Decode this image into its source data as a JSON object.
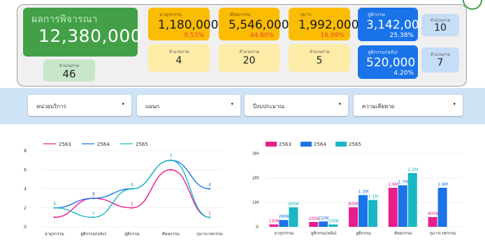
{
  "colors": {
    "green": "#43a047",
    "orange": "#fbbc04",
    "pale_yellow": "#fdeca8",
    "blue": "#1a73e8",
    "light_blue": "#c6ddf7",
    "pink": "#e91e8c",
    "teal": "#1ab8c4",
    "red": "#ea4335"
  },
  "summary": {
    "main_title": "ผลการพิจารณา",
    "main_value": "12,380,000",
    "count_label": "จำนวนราย",
    "count_value": "46",
    "cards": [
      {
        "title": "อายุรกรรม",
        "value": "1,180,000",
        "pct": "9.53%",
        "count_label": "จำนวนราย",
        "count": "4"
      },
      {
        "title": "ศัลยกรรม",
        "value": "5,546,000",
        "pct": "44.80%",
        "count_label": "จำนวนราย",
        "count": "20"
      },
      {
        "title": "กุมาร",
        "value": "1,992,000",
        "pct": "16.09%",
        "count_label": "จำนวนราย",
        "count": "5"
      }
    ],
    "blue_cards": [
      {
        "title": "สูติกรรม",
        "value": "3,142,000",
        "pct": "25.38%",
        "count_label": "จำนวนราย",
        "count": "10"
      },
      {
        "title": "สูติกรรม(หลัง)",
        "value": "520,000",
        "pct": "4.20%",
        "count_label": "จำนวนราย",
        "count": "7"
      }
    ]
  },
  "filters": [
    {
      "label": "หน่วยบริการ",
      "caret": "▾"
    },
    {
      "label": "แผนก",
      "caret": "▾"
    },
    {
      "label": "ปีงบประมาณ",
      "caret": "▾"
    },
    {
      "label": "ความเสียหาย",
      "caret": "▾"
    }
  ],
  "chart_data": [
    {
      "type": "line",
      "categories": [
        "อายุรกรรม",
        "สูติกรรม(หลัง)",
        "สูติกรรม",
        "ศัลยกรรม",
        "กุมารเวชกรรม"
      ],
      "series": [
        {
          "name": "2563",
          "color": "#e91e8c",
          "values": [
            1,
            3,
            2,
            6,
            1
          ],
          "labels": [
            "",
            "3",
            "2",
            "",
            "1"
          ]
        },
        {
          "name": "2564",
          "color": "#1a73e8",
          "values": [
            2,
            3,
            4,
            7,
            4
          ],
          "labels": [
            "2",
            "3",
            "4",
            "7",
            "4"
          ]
        },
        {
          "name": "2565",
          "color": "#1ab8c4",
          "values": [
            2,
            1,
            4,
            7,
            1
          ],
          "labels": [
            "2",
            "1",
            "4",
            "7",
            ""
          ]
        }
      ],
      "ylim": [
        0,
        8
      ],
      "yticks": [
        "0",
        "2",
        "4",
        "6",
        "8"
      ],
      "grid": true,
      "legend": "top"
    },
    {
      "type": "bar",
      "categories": [
        "อายุรกรรม",
        "สูติกรรม(หลัง)",
        "สูติกรรม",
        "ศัลยกรรม",
        "กุมารเวชกรรม"
      ],
      "series": [
        {
          "name": "2563",
          "color": "#e91e8c",
          "values": [
            100000,
            200000,
            800000,
            1600000,
            400000
          ],
          "labels": [
            "100K",
            "200K",
            "800K",
            "1.6M",
            "400K"
          ]
        },
        {
          "name": "2564",
          "color": "#1a73e8",
          "values": [
            280000,
            220000,
            1300000,
            1700000,
            1600000
          ],
          "labels": [
            "280K",
            "220K",
            "1.3M",
            "1.7M",
            "1.6M"
          ]
        },
        {
          "name": "2565",
          "color": "#1ab8c4",
          "values": [
            800000,
            100000,
            1100000,
            2200000,
            0
          ],
          "labels": [
            "800K",
            "100K",
            "1.1M",
            "2.2M",
            ""
          ]
        }
      ],
      "ylim": [
        0,
        3000000
      ],
      "yticks": [
        "0",
        "1M",
        "2M",
        "3M"
      ],
      "grid": true,
      "legend": "top"
    }
  ]
}
